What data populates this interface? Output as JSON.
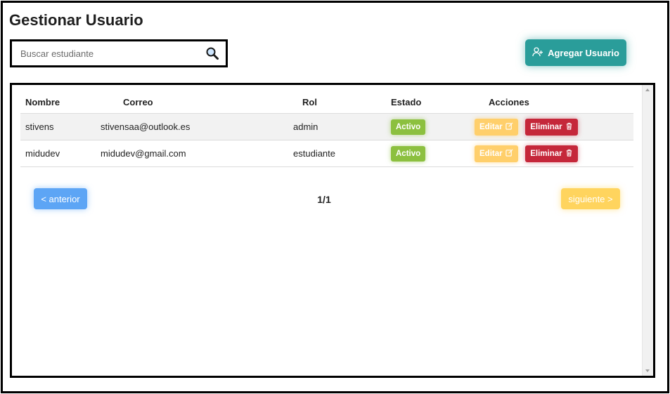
{
  "page": {
    "title": "Gestionar Usuario"
  },
  "search": {
    "placeholder": "Buscar estudiante",
    "value": ""
  },
  "add_button": {
    "label": "Agregar Usuario"
  },
  "table": {
    "headers": [
      "Nombre",
      "Correo",
      "Rol",
      "Estado",
      "Acciones"
    ],
    "rows": [
      {
        "nombre": "stivens",
        "correo": "stivensaa@outlook.es",
        "rol": "admin",
        "estado": "Activo"
      },
      {
        "nombre": "midudev",
        "correo": "midudev@gmail.com",
        "rol": "estudiante",
        "estado": "Activo"
      }
    ],
    "edit_label": "Editar",
    "delete_label": "Eliminar"
  },
  "pagination": {
    "prev_label": "< anterior",
    "next_label": "siguiente >",
    "page_indicator": "1/1"
  },
  "colors": {
    "primary_teal": "#2a9d9a",
    "status_active": "#8cc03f",
    "edit": "#ffcf6b",
    "delete": "#c5273a",
    "prev": "#5da5f5",
    "next": "#ffd45e"
  },
  "icons": {
    "search": "search-icon",
    "add_user": "user-plus-icon",
    "edit": "edit-icon",
    "delete": "trash-icon"
  }
}
